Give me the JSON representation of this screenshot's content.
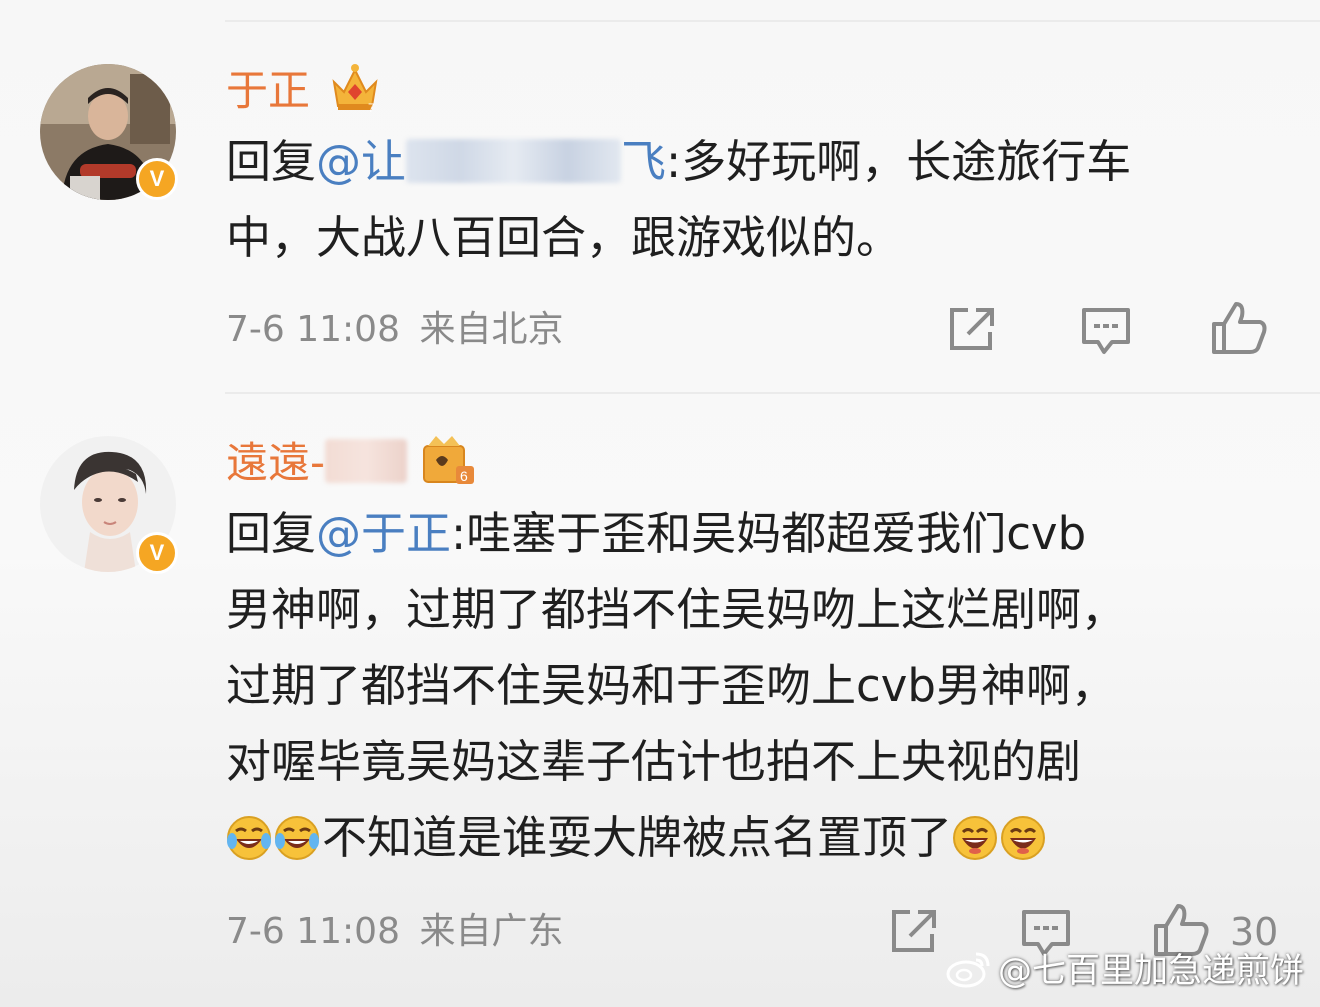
{
  "comments": [
    {
      "username": "于正",
      "level_icon": "crown-level-7-icon",
      "reply_prefix": "回复",
      "mention_start": "@让",
      "mention_end": "飞",
      "text_line1": ":多好玩啊，长途旅行车",
      "text_line2": "中，大战八百回合，跟游戏似的。",
      "time": "7-6 11:08",
      "location": "来自北京",
      "actions": [
        "share-icon",
        "comment-icon",
        "like-icon"
      ]
    },
    {
      "username_prefix": "遠遠-",
      "level_icon": "crown-level-6-icon",
      "reply_prefix": "回复",
      "mention": "@于正",
      "text_line1": ":哇塞于歪和吴妈都超爱我们cvb",
      "text_line2": "男神啊，过期了都挡不住吴妈吻上这烂剧啊，",
      "text_line3": "过期了都挡不住吴妈和于歪吻上cvb男神啊，",
      "text_line4": "对喔毕竟吴妈这辈子估计也拍不上央视的剧",
      "text_line5": "不知道是谁耍大牌被点名置顶了",
      "emojis_before": [
        "laugh-cry-icon",
        "laugh-cry-icon"
      ],
      "emojis_after": [
        "laugh-icon",
        "laugh-icon"
      ],
      "time": "7-6 11:08",
      "location": "来自广东",
      "like_count": "30",
      "actions": [
        "share-icon",
        "comment-icon",
        "like-icon"
      ]
    }
  ],
  "watermark": {
    "text": "@七百里加急递煎饼",
    "logo": "weibo-logo-icon"
  },
  "colors": {
    "username": "#e8773a",
    "mention": "#4a7fc1",
    "meta": "#8a8a8a",
    "verified": "#f5a623"
  }
}
